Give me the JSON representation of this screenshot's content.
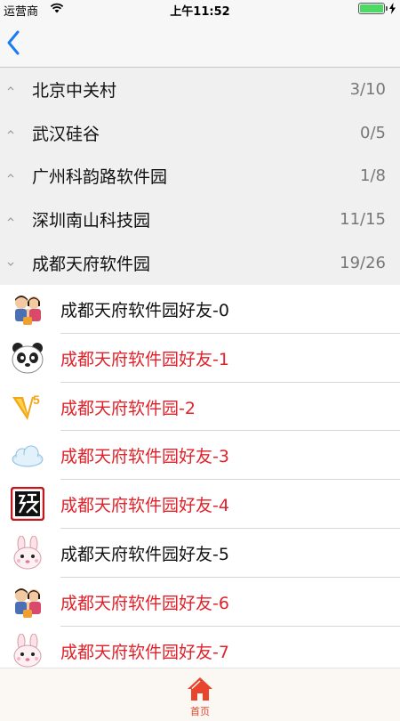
{
  "status_bar": {
    "carrier": "运营商",
    "time": "上午11:52",
    "battery_level": 1.0
  },
  "groups": [
    {
      "name": "北京中关村",
      "count": "3/10",
      "expanded": false
    },
    {
      "name": "武汉硅谷",
      "count": "0/5",
      "expanded": false
    },
    {
      "name": "广州科韵路软件园",
      "count": "1/8",
      "expanded": false
    },
    {
      "name": "深圳南山科技园",
      "count": "11/15",
      "expanded": false
    },
    {
      "name": "成都天府软件园",
      "count": "19/26",
      "expanded": true
    }
  ],
  "friends": [
    {
      "name": "成都天府软件园好友-0",
      "vip": false,
      "avatar": "family-avatar-icon"
    },
    {
      "name": "成都天府软件园好友-1",
      "vip": true,
      "avatar": "panda-avatar-icon"
    },
    {
      "name": "成都天府软件园-2",
      "vip": true,
      "avatar": "vip5-avatar-icon"
    },
    {
      "name": "成都天府软件园好友-3",
      "vip": true,
      "avatar": "cloud-avatar-icon"
    },
    {
      "name": "成都天府软件园好友-4",
      "vip": true,
      "avatar": "seal-avatar-icon"
    },
    {
      "name": "成都天府软件园好友-5",
      "vip": false,
      "avatar": "rabbit-avatar-icon"
    },
    {
      "name": "成都天府软件园好友-6",
      "vip": true,
      "avatar": "family-avatar-icon"
    },
    {
      "name": "成都天府软件园好友-7",
      "vip": true,
      "avatar": "rabbit-avatar-icon"
    }
  ],
  "tab_bar": {
    "home_label": "首页",
    "home_icon": "home-icon"
  },
  "colors": {
    "accent": "#e8452c",
    "vip_text": "#e0222a",
    "back_blue": "#1a7cf5"
  }
}
